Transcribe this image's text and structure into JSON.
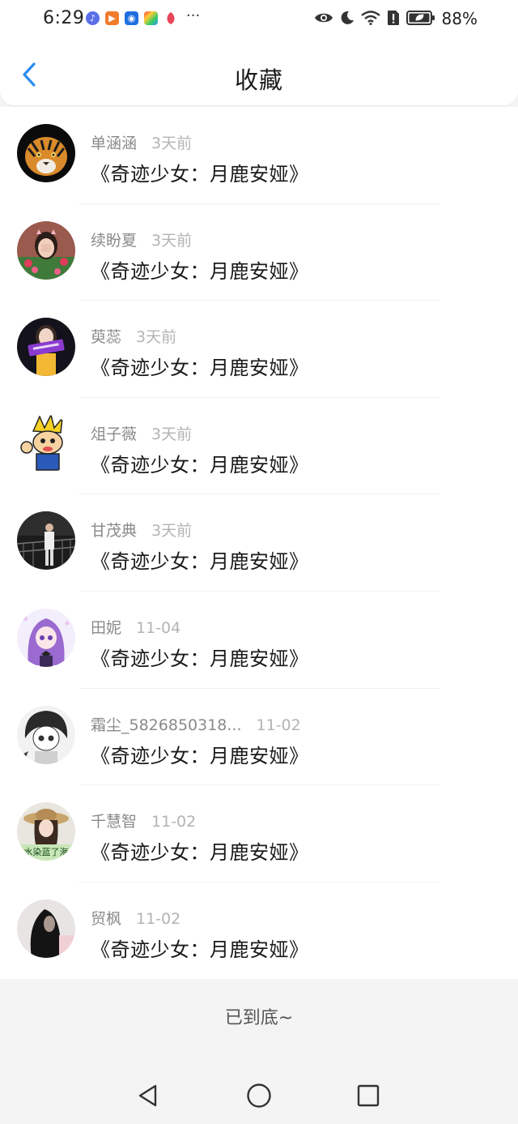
{
  "status_bar": {
    "time": "6:29",
    "more": "···",
    "battery": "88%",
    "app_icons": [
      "music-app-icon",
      "video-app-icon",
      "bulb-app-icon",
      "palette-app-icon",
      "petal-app-icon"
    ]
  },
  "header": {
    "title": "收藏",
    "accent_color": "#2b8cf0"
  },
  "items": [
    {
      "name": "单涵涵",
      "time": "3天前",
      "title": "《奇迹少女：月鹿安娅》"
    },
    {
      "name": "续盼夏",
      "time": "3天前",
      "title": "《奇迹少女：月鹿安娅》"
    },
    {
      "name": "萸蕊",
      "time": "3天前",
      "title": "《奇迹少女：月鹿安娅》"
    },
    {
      "name": "俎子薇",
      "time": "3天前",
      "title": "《奇迹少女：月鹿安娅》"
    },
    {
      "name": "甘茂典",
      "time": "3天前",
      "title": "《奇迹少女：月鹿安娅》"
    },
    {
      "name": "田妮",
      "time": "11-04",
      "title": "《奇迹少女：月鹿安娅》"
    },
    {
      "name": "霜尘_5826850318...",
      "time": "11-02",
      "title": "《奇迹少女：月鹿安娅》"
    },
    {
      "name": "千慧智",
      "time": "11-02",
      "title": "《奇迹少女：月鹿安娅》",
      "avatar_caption": "水染蓝了海"
    },
    {
      "name": "贸枫",
      "time": "11-02",
      "title": "《奇迹少女：月鹿安娅》"
    }
  ],
  "footer": {
    "end_text": "已到底~"
  }
}
